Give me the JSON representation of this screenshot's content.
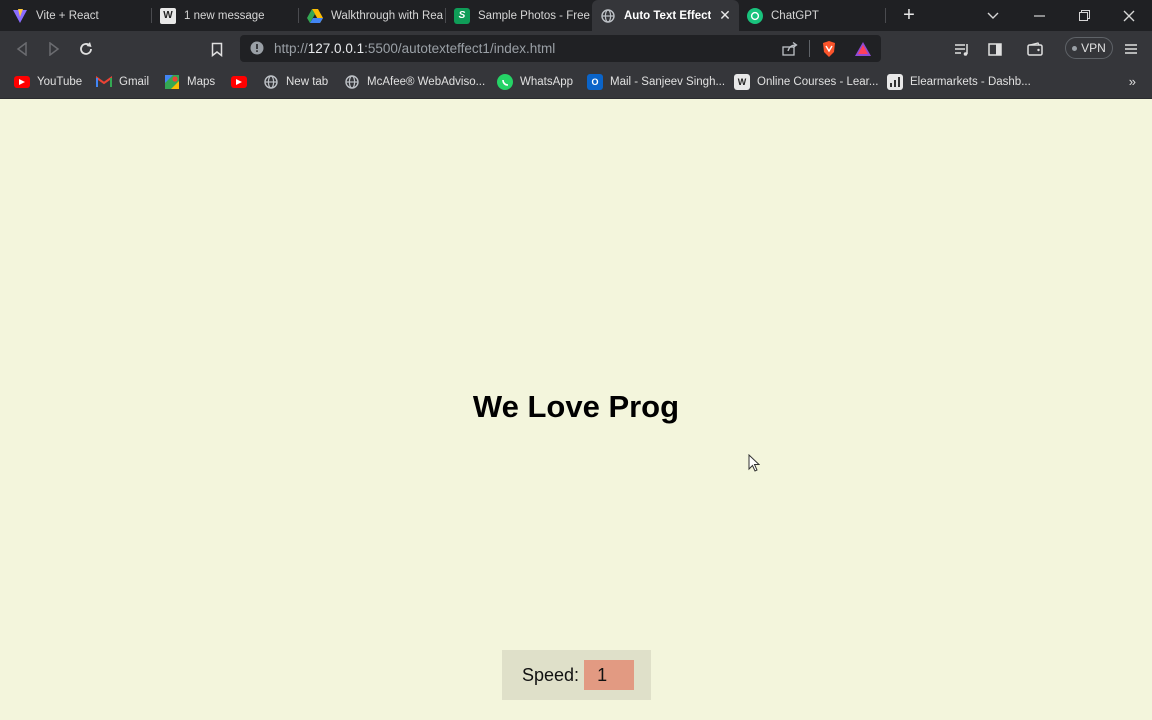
{
  "browser": {
    "tabs": [
      {
        "label": "Vite + React",
        "icon": "vite-icon",
        "active": false
      },
      {
        "label": "1 new message",
        "icon": "wordpress-icon",
        "active": false
      },
      {
        "label": "Walkthrough with Rea",
        "icon": "google-drive-icon",
        "active": false
      },
      {
        "label": "Sample Photos - Free",
        "icon": "sheets-icon",
        "active": false
      },
      {
        "label": "Auto Text Effect",
        "icon": "globe-icon",
        "active": true
      },
      {
        "label": "ChatGPT",
        "icon": "chatgpt-icon",
        "active": false
      }
    ],
    "url": {
      "scheme": "http://",
      "host": "127.0.0.1",
      "rest": ":5500/autotexteffect1/index.html"
    },
    "vpn_label": "VPN",
    "bookmarks": [
      {
        "label": "YouTube",
        "icon": "youtube-icon"
      },
      {
        "label": "Gmail",
        "icon": "gmail-icon"
      },
      {
        "label": "Maps",
        "icon": "maps-icon"
      },
      {
        "label": "",
        "icon": "youtube-icon"
      },
      {
        "label": "New tab",
        "icon": "globe-icon"
      },
      {
        "label": "McAfee® WebAdviso...",
        "icon": "globe-icon"
      },
      {
        "label": "WhatsApp",
        "icon": "whatsapp-icon"
      },
      {
        "label": "Mail - Sanjeev Singh...",
        "icon": "outlook-icon"
      },
      {
        "label": "Online Courses - Lear...",
        "icon": "courses-icon"
      },
      {
        "label": "Elearmarkets - Dashb...",
        "icon": "elearnmarkets-icon"
      }
    ]
  },
  "page": {
    "headline": "We Love Prog",
    "speed_label": "Speed:",
    "speed_value": "1"
  },
  "colors": {
    "page_background": "#f3f5dc",
    "speed_panel": "#dfe0c9",
    "speed_input": "#e29a82"
  }
}
